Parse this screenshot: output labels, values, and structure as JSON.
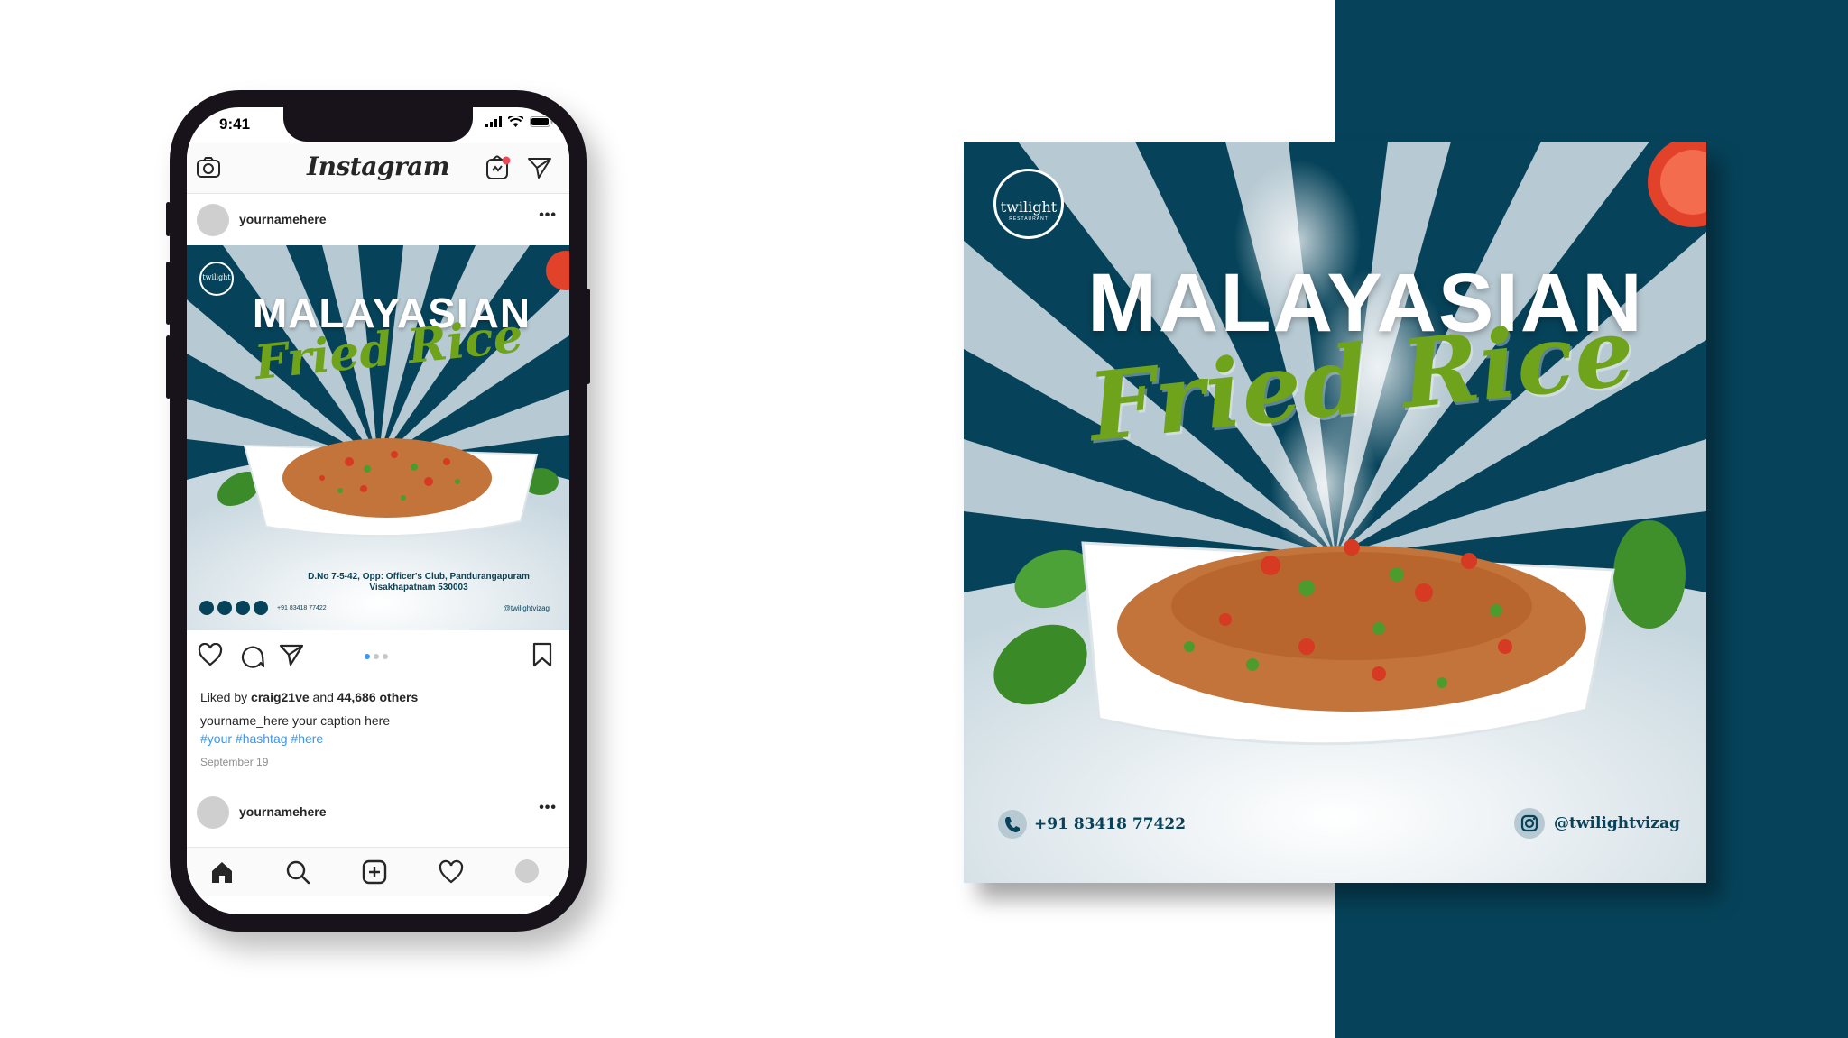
{
  "status_bar": {
    "time": "9:41"
  },
  "instagram": {
    "logo": "Instagram",
    "post1_username": "yournamehere",
    "post2_username": "yournamehere",
    "more_label": "•••",
    "liked_prefix": "Liked by",
    "liked_user": "craig21ve",
    "liked_and": "and",
    "liked_count": "44,686 others",
    "caption_user": "yourname_here",
    "caption_text": "your caption here",
    "hashtags": "#your #hashtag #here",
    "date": "September 19",
    "carousel": {
      "count": 3,
      "active": 1
    },
    "icons": {
      "camera": "camera-icon",
      "igtv": "igtv-icon",
      "direct": "direct-message-icon",
      "like": "heart-icon",
      "comment": "comment-icon",
      "share": "share-icon",
      "save": "bookmark-icon",
      "home": "home-icon",
      "search": "search-icon",
      "add": "add-post-icon",
      "activity": "activity-heart-icon",
      "profile": "profile-avatar"
    }
  },
  "flyer": {
    "brand": "twilight",
    "brand_sub": "RESTAURANT",
    "title": "MALAYASIAN",
    "subtitle": "Fried Rice",
    "address_line1": "D.No 7-5-42, Opp: Officer's Club, Pandurangapuram",
    "address_line2": "Visakhapatnam 530003",
    "mini_phone": "+91 83418 77422",
    "mini_handle": "@twilightvizag",
    "phone": "+91 83418 77422",
    "handle": "@twilightvizag"
  },
  "colors": {
    "teal": "#06435a",
    "light_blue": "#b7c9d2",
    "green": "#6ea31b",
    "ig_blue": "#3897f0",
    "phone_body": "#18121a"
  }
}
